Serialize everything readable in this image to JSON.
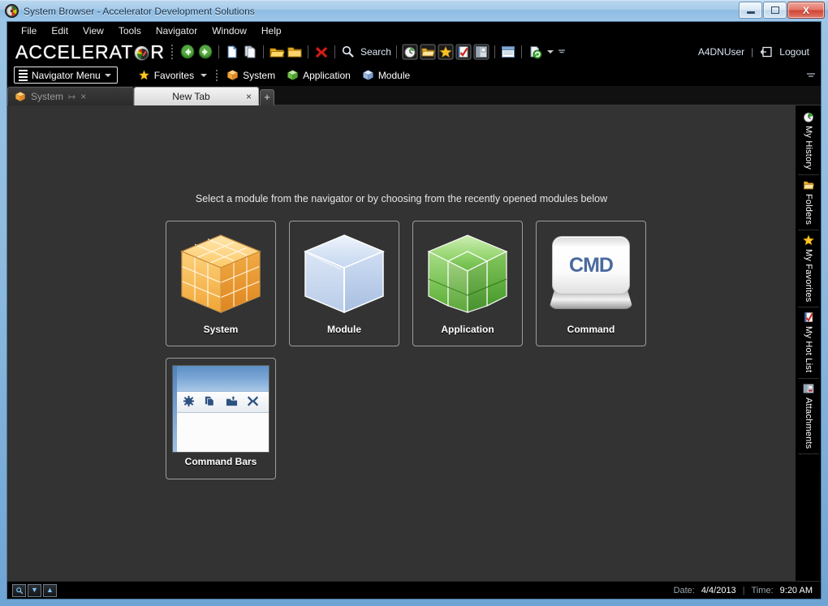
{
  "window": {
    "icon": "gauge-icon",
    "title": "System Browser - Accelerator Development Solutions",
    "minimize_label": "–",
    "maximize_label": "",
    "close_label": "X"
  },
  "menubar": {
    "items": [
      {
        "label": "File"
      },
      {
        "label": "Edit"
      },
      {
        "label": "View"
      },
      {
        "label": "Tools"
      },
      {
        "label": "Navigator"
      },
      {
        "label": "Window"
      },
      {
        "label": "Help"
      }
    ]
  },
  "brandbar": {
    "logo_pre": "ACCELERAT",
    "logo_post": "R",
    "logo_icon": "gauge-icon",
    "toolbar_left": [
      {
        "name": "back-icon",
        "title": "Back"
      },
      {
        "name": "forward-icon",
        "title": "Forward"
      },
      {
        "name": "new-document-icon",
        "title": "New"
      },
      {
        "name": "copy-icon",
        "title": "Copy"
      },
      {
        "name": "open-folder-icon",
        "title": "Open"
      },
      {
        "name": "folder-icon",
        "title": "Folder"
      },
      {
        "name": "delete-icon",
        "title": "Delete"
      }
    ],
    "search_label": "Search",
    "toolbar_right": [
      {
        "name": "history-icon",
        "title": "My History"
      },
      {
        "name": "folders-icon",
        "title": "Folders"
      },
      {
        "name": "favorites-star-icon",
        "title": "My Favorites"
      },
      {
        "name": "hotlist-icon",
        "title": "My Hot List"
      },
      {
        "name": "attachments-icon",
        "title": "Attachments"
      },
      {
        "name": "window-icon",
        "title": "Window"
      },
      {
        "name": "refresh-icon",
        "title": "Refresh"
      }
    ],
    "user": "A4DNUser",
    "separator": "|",
    "logout_label": "Logout",
    "logout_icon": "logout-icon"
  },
  "navbar": {
    "menu_button_label": "Navigator Menu",
    "menu_button_icon": "hamburger-icon",
    "links": [
      {
        "label": "Favorites",
        "icon": "star-icon",
        "has_caret": true
      },
      {
        "label": "System",
        "icon": "orange-cube-icon",
        "has_caret": false
      },
      {
        "label": "Application",
        "icon": "green-cube-icon",
        "has_caret": false
      },
      {
        "label": "Module",
        "icon": "blue-cube-icon",
        "has_caret": false
      }
    ],
    "collapse_icon": "collapse-icon"
  },
  "tabs": {
    "items": [
      {
        "label": "System",
        "icon": "orange-cube-icon",
        "active": false,
        "pin_icon": "pin-icon",
        "close_icon": "×"
      },
      {
        "label": "New Tab",
        "icon": "",
        "active": true,
        "close_icon": "×"
      }
    ],
    "new_tab_label": "+"
  },
  "content": {
    "hint": "Select a module from the navigator or by choosing from the recently opened modules below",
    "tiles": [
      {
        "label": "System",
        "art": "orange-rubik-cube"
      },
      {
        "label": "Module",
        "art": "blue-hollow-cube"
      },
      {
        "label": "Application",
        "art": "green-notched-cube"
      },
      {
        "label": "Command",
        "art": "cmd-key",
        "key_text": "CMD"
      },
      {
        "label": "Command Bars",
        "art": "mini-window",
        "bar_icons": [
          "✶",
          "❐",
          "⬆",
          "✖"
        ]
      }
    ]
  },
  "sidebar": {
    "items": [
      {
        "label": "My History",
        "icon": "history-icon"
      },
      {
        "label": "Folders",
        "icon": "folders-icon"
      },
      {
        "label": "My Favorites",
        "icon": "star-icon"
      },
      {
        "label": "My Hot List",
        "icon": "hotlist-icon"
      },
      {
        "label": "Attachments",
        "icon": "attachments-icon"
      }
    ]
  },
  "statusbar": {
    "buttons": [
      {
        "name": "status-search-button",
        "glyph": "⚲"
      },
      {
        "name": "status-down-button",
        "glyph": "▼"
      },
      {
        "name": "status-up-button",
        "glyph": "▲"
      }
    ],
    "date_label": "Date:",
    "date_value": "4/4/2013",
    "divider": "|",
    "time_label": "Time:",
    "time_value": "9:20 AM"
  },
  "colors": {
    "frame": "#8fbbdf",
    "content_bg": "#333333",
    "chrome_bg": "#000000",
    "accent_blue": "#4a6a9e",
    "system_orange": "#f0a63c",
    "application_green": "#6fbf4a",
    "module_blue": "#b8cdea"
  }
}
